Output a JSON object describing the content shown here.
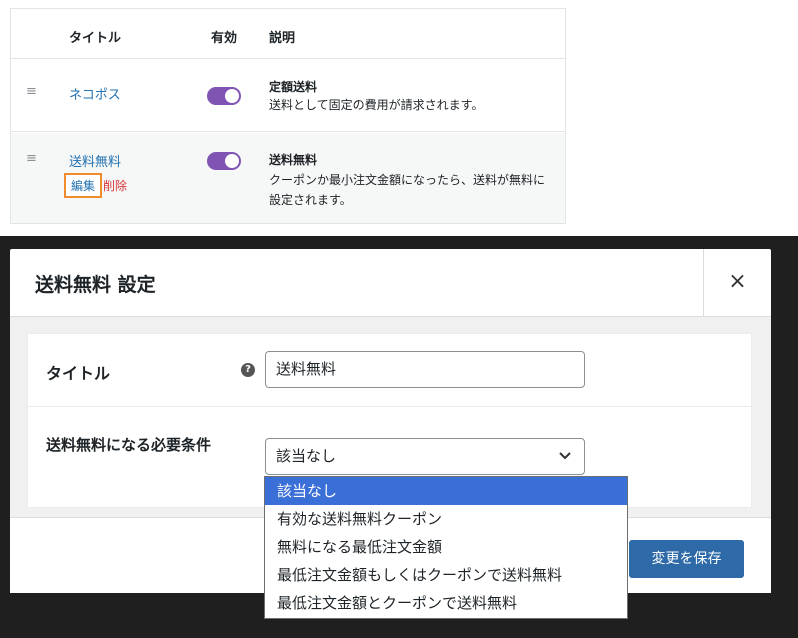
{
  "methods_table": {
    "headers": {
      "title": "タイトル",
      "enabled": "有効",
      "description": "説明"
    },
    "rows": [
      {
        "title": "ネコポス",
        "enabled": true,
        "desc_title": "定額送料",
        "desc_text": "送料として固定の費用が請求されます。"
      },
      {
        "title": "送料無料",
        "enabled": true,
        "desc_title": "送料無料",
        "desc_text": "クーポンか最小注文金額になったら、送料が無料に設定されます。",
        "edit_label": "編集",
        "delete_label": "削除"
      }
    ]
  },
  "modal": {
    "title": "送料無料 設定",
    "close_label": "×",
    "fields": {
      "title_label": "タイトル",
      "title_value": "送料無料",
      "requirement_label": "送料無料になる必要条件",
      "requirement_value": "該当なし"
    },
    "save_label": "変更を保存"
  },
  "dropdown": {
    "options": [
      "該当なし",
      "有効な送料無料クーポン",
      "無料になる最低注文金額",
      "最低注文金額もしくはクーポンで送料無料",
      "最低注文金額とクーポンで送料無料"
    ],
    "selected_index": 0
  },
  "colors": {
    "toggle_on": "#7f54b3",
    "link": "#2271b1",
    "delete": "#d63638",
    "save_button": "#2e6aa8",
    "option_highlight": "#3a6fd8"
  },
  "icons": {
    "drag": "drag-handle-icon",
    "help": "help-circle-icon",
    "close": "close-icon",
    "chevron": "chevron-down-icon"
  }
}
